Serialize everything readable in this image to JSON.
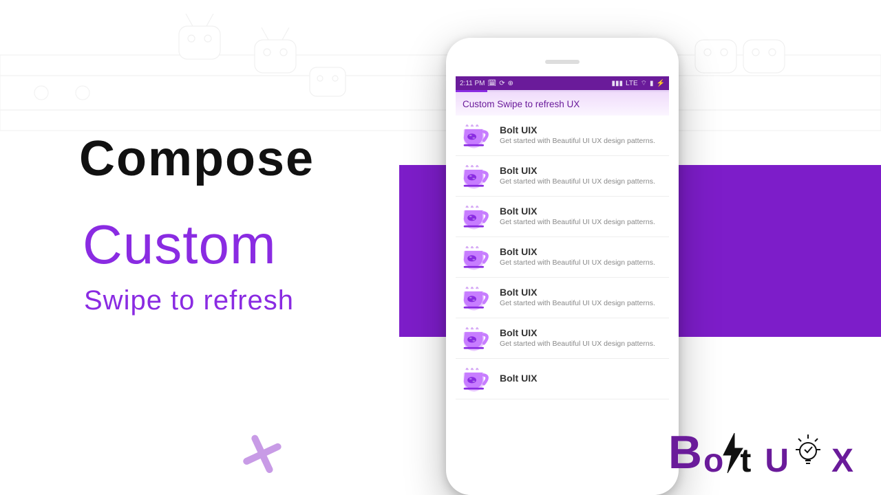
{
  "headings": {
    "compose": "Compose",
    "custom": "Custom",
    "swipe": "Swipe to refresh"
  },
  "phone": {
    "status": {
      "time": "2:11 PM",
      "network_label": "LTE"
    },
    "app_title": "Custom Swipe to refresh UX",
    "items": [
      {
        "title": "Bolt UIX",
        "subtitle": "Get started with Beautiful UI UX design patterns."
      },
      {
        "title": "Bolt UIX",
        "subtitle": "Get started with Beautiful UI UX design patterns."
      },
      {
        "title": "Bolt UIX",
        "subtitle": "Get started with Beautiful UI UX design patterns."
      },
      {
        "title": "Bolt UIX",
        "subtitle": "Get started with Beautiful UI UX design patterns."
      },
      {
        "title": "Bolt UIX",
        "subtitle": "Get started with Beautiful UI UX design patterns."
      },
      {
        "title": "Bolt UIX",
        "subtitle": "Get started with Beautiful UI UX design patterns."
      },
      {
        "title": "Bolt UIX",
        "subtitle": ""
      }
    ]
  },
  "logo": {
    "B": "B",
    "o": "o",
    "t": "t",
    "U": "U",
    "X": "X"
  },
  "colors": {
    "brand_purple": "#8a2be2",
    "deep_purple": "#6a1b9a",
    "block_purple": "#7d1dc9"
  }
}
